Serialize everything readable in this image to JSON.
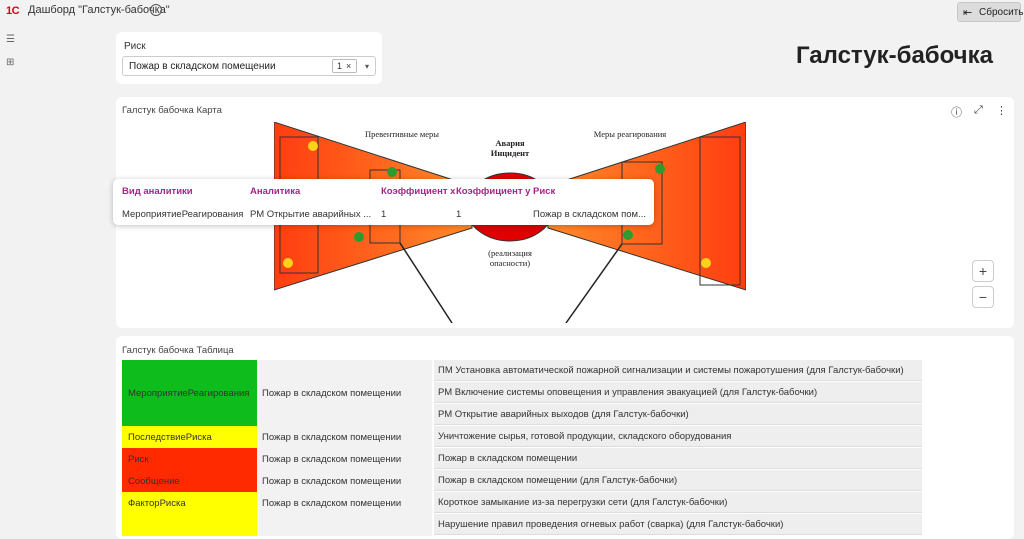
{
  "app": {
    "logo": "1С",
    "title": "Дашборд \"Галстук-бабочка\"",
    "info_icon": "info-icon",
    "reset_label": "Сбросить",
    "reset_icon": "reset-arrow-icon"
  },
  "sidebar": {
    "icons": [
      "list-icon",
      "dashboard-icon"
    ]
  },
  "filter": {
    "label": "Риск",
    "value": "Пожар в складском помещении",
    "count": "1",
    "clear": "×",
    "dropdown": "▾"
  },
  "page": {
    "title": "Галстук-бабочка"
  },
  "map": {
    "title": "Галстук бабочка Карта",
    "labels": {
      "preventive": "Превентивные меры",
      "accident": "Авария",
      "incident": "Инцидент",
      "response": "Меры реагирования",
      "realization1": "(реализация",
      "realization2": "опасности)"
    },
    "colors": {
      "left_gradient": "#ff5a1f",
      "right_gradient": "#ff5a1f",
      "center": "#e00000",
      "yellow_dot": "#ffd21a",
      "green_dot": "#2e9b2e"
    },
    "zoom_in": "+",
    "zoom_out": "−",
    "tooltip": {
      "headers": [
        "Вид аналитики",
        "Аналитика",
        "Коэффициент x",
        "Коэффициент y",
        "Риск"
      ],
      "values": [
        "МероприятиеРеагирования",
        "РМ Открытие аварийных ...",
        "1",
        "1",
        "Пожар в складском пом..."
      ]
    }
  },
  "table": {
    "title": "Галстук бабочка Таблица",
    "colors": {
      "green": "#0ebc1b",
      "yellow": "#ffff00",
      "red": "#ff2a00"
    },
    "groups": [
      {
        "category": "",
        "risk": "",
        "items": [
          "ПМ Установка автоматической пожарной сигнализации и системы пожаротушения (для Галстук-бабочки)"
        ]
      },
      {
        "category": "МероприятиеРеагирования",
        "risk": "Пожар в складском помещении",
        "items": [
          "РМ Включение системы оповещения и управления эвакуацией (для Галстук-бабочки)",
          "РМ Открытие аварийных выходов (для Галстук-бабочки)"
        ]
      },
      {
        "category": "ПоследствиеРиска",
        "risk": "Пожар в складском помещении",
        "items": [
          "Уничтожение сырья, готовой продукции, складского оборудования"
        ]
      },
      {
        "category": "Риск",
        "risk": "Пожар в складском помещении",
        "items": [
          "Пожар в складском помещении"
        ]
      },
      {
        "category": "Сообщение",
        "risk": "Пожар в складском помещении",
        "items": [
          "Пожар в складском помещении (для Галстук-бабочки)"
        ]
      },
      {
        "category": "ФакторРиска",
        "risk": "Пожар в складском помещении",
        "items": [
          "Короткое замыкание из-за перегрузки сети (для Галстук-бабочки)",
          "Нарушение правил проведения огневых работ (сварка) (для Галстук-бабочки)"
        ]
      }
    ]
  }
}
